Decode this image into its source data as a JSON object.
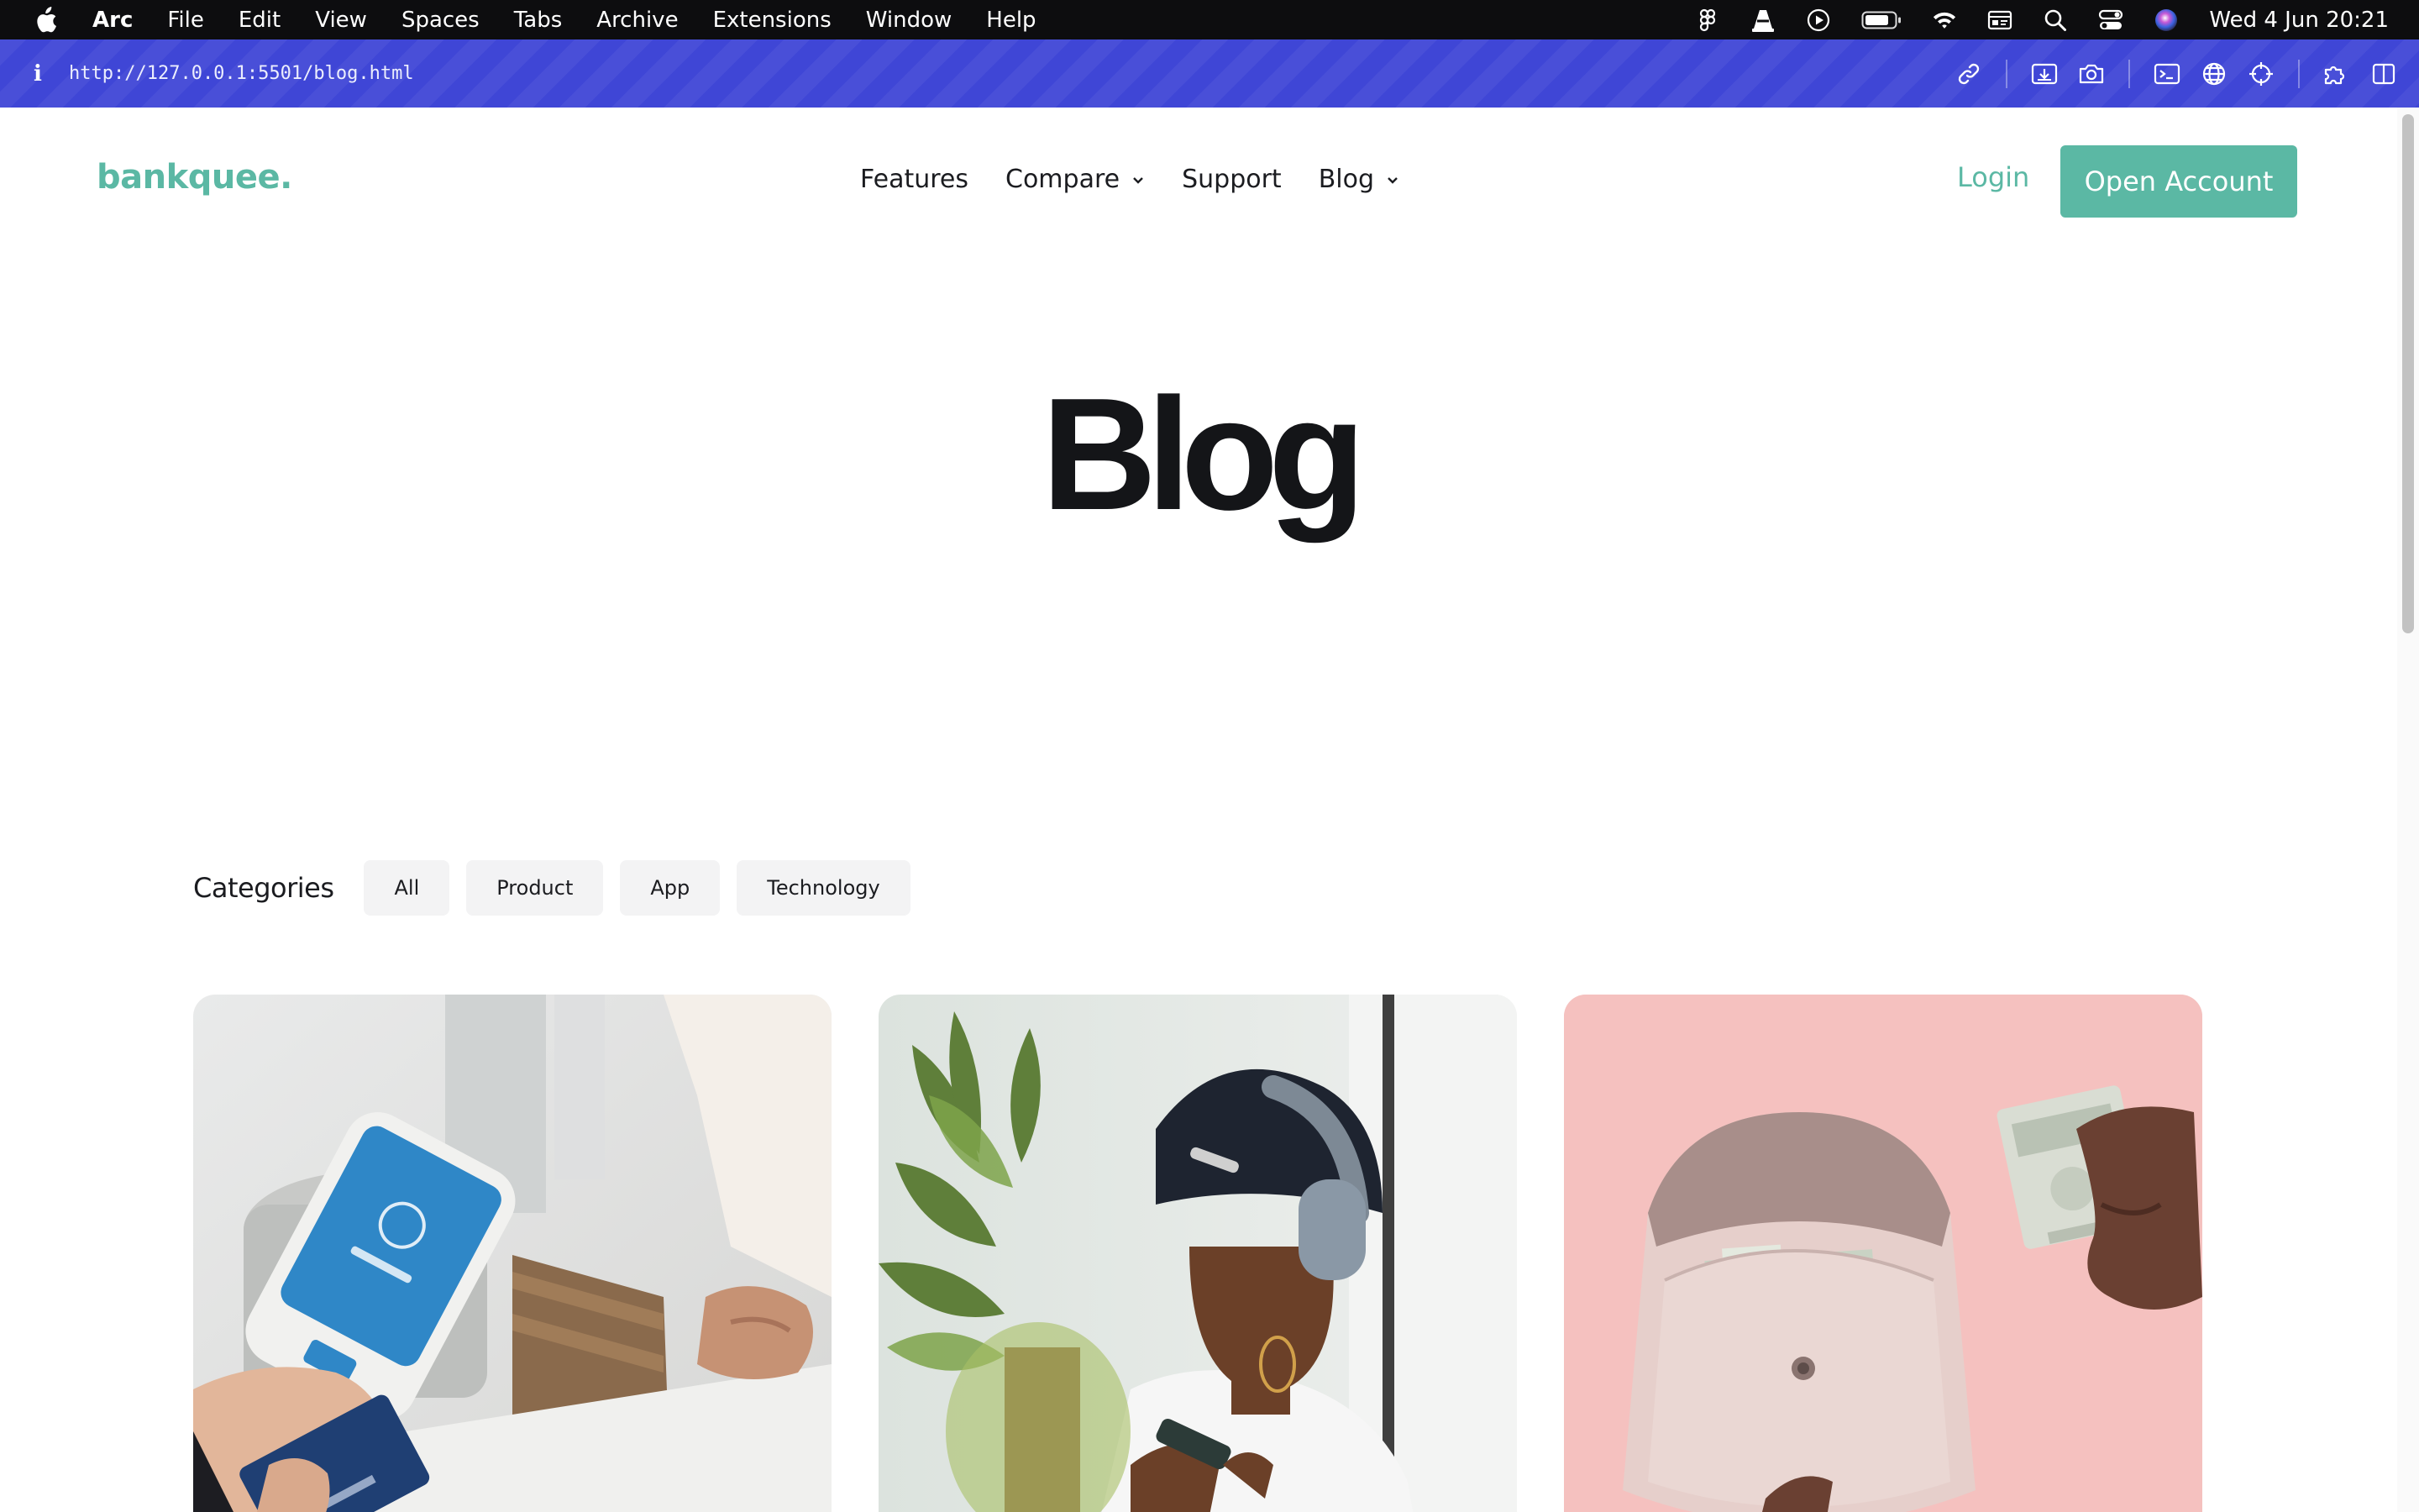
{
  "menubar": {
    "apple_icon": "apple-logo-icon",
    "items": [
      "Arc",
      "File",
      "Edit",
      "View",
      "Spaces",
      "Tabs",
      "Archive",
      "Extensions",
      "Window",
      "Help"
    ],
    "status_icons": [
      "figma-icon",
      "vlc-icon",
      "play-icon",
      "battery-icon",
      "wifi-icon",
      "display-icon",
      "search-icon",
      "control-center-icon",
      "siri-icon"
    ],
    "clock": "Wed 4 Jun  20:21"
  },
  "browser": {
    "url": "http://127.0.0.1:5501/blog.html",
    "accent": "#3f46d6",
    "tools": [
      "link-icon",
      "capture-icon",
      "camera-icon",
      "console-icon",
      "globe-icon",
      "crosshair-icon",
      "extensions-icon",
      "split-view-icon"
    ]
  },
  "site": {
    "logo": "bankquee.",
    "brand_color": "#5bb8a4",
    "nav": [
      {
        "label": "Features",
        "dropdown": false
      },
      {
        "label": "Compare",
        "dropdown": true
      },
      {
        "label": "Support",
        "dropdown": false
      },
      {
        "label": "Blog",
        "dropdown": true
      }
    ],
    "login": "Login",
    "cta": "Open Account"
  },
  "hero": {
    "title": "Blog"
  },
  "categories": {
    "label": "Categories",
    "chips": [
      "All",
      "Product",
      "App",
      "Technology"
    ]
  },
  "posts": [
    {
      "image": "card-payment-terminal-photo"
    },
    {
      "image": "woman-headphones-phone-photo"
    },
    {
      "image": "pink-wallet-cash-photo"
    }
  ]
}
